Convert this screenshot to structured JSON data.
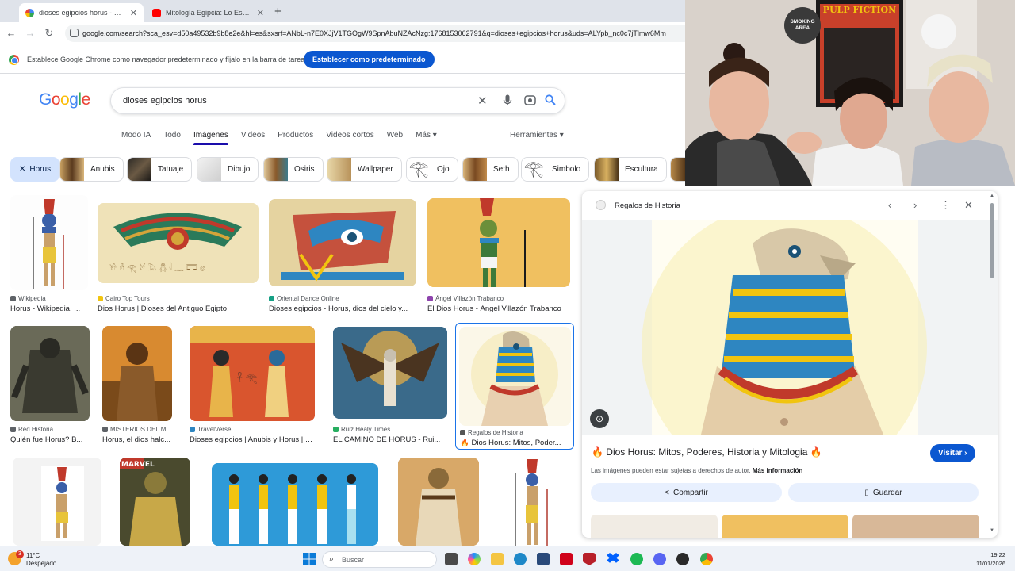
{
  "browser": {
    "tabs": [
      {
        "title": "dioses egipcios horus - Buscar",
        "active": true
      },
      {
        "title": "Mitología Egipcia: Lo Esencial -",
        "active": false
      }
    ],
    "url": "google.com/search?sca_esv=d50a49532b9b8e2e&hl=es&sxsrf=ANbL-n7E0XJjV1TGOgW9SpnAbuNZAcNzg:1768153062791&q=dioses+egipcios+horus&uds=ALYpb_nc0c7jTlmw6Mm",
    "infobar": {
      "message": "Establece Google Chrome como navegador predeterminado y fíjalo en la barra de tareas",
      "button": "Establecer como predeterminado"
    }
  },
  "google": {
    "logo": "Google",
    "query": "dioses egipcios horus",
    "nav": [
      "Modo IA",
      "Todo",
      "Imágenes",
      "Videos",
      "Productos",
      "Videos cortos",
      "Web",
      "Más ▾"
    ],
    "active_nav": "Imágenes",
    "tools": "Herramientas ▾",
    "chips": [
      "Horus",
      "Anubis",
      "Tatuaje",
      "Dibujo",
      "Osiris",
      "Wallpaper",
      "Ojo",
      "Seth",
      "Simbolo",
      "Escultura"
    ]
  },
  "results": [
    {
      "source": "Wikipedia",
      "title": "Horus - Wikipedia, ..."
    },
    {
      "source": "Cairo Top Tours",
      "title": "Dios Horus | Dioses del Antiguo Egipto"
    },
    {
      "source": "Oriental Dance Online",
      "title": "Dioses egipcios - Horus, dios del cielo y..."
    },
    {
      "source": "Ángel Villazón Trabanco",
      "title": "El Dios Horus - Ángel Villazón Trabanco"
    },
    {
      "source": "Red Historia",
      "title": "Quién fue Horus? B..."
    },
    {
      "source": "MISTERIOS DEL M...",
      "title": "Horus, el dios halc..."
    },
    {
      "source": "TravelVerse",
      "title": "Dioses egipcios | Anubis y Horus | T..."
    },
    {
      "source": "Ruiz Healy Times",
      "title": "EL CAMINO DE HORUS - Rui..."
    },
    {
      "source": "Regalos de Historia",
      "title": "🔥 Dios Horus: Mitos, Poder..."
    }
  ],
  "panel": {
    "source": "Regalos de Historia",
    "title": "🔥 Dios Horus: Mitos, Poderes, Historia y Mitologia 🔥",
    "visit": "Visitar ›",
    "copyright": "Las imágenes pueden estar sujetas a derechos de autor.",
    "more_info": "Más información",
    "share": "Compartir",
    "save": "Guardar"
  },
  "webcam": {
    "sign": "SMOKING AREA",
    "poster": "PULP FICTION"
  },
  "taskbar": {
    "temp": "11°C",
    "weather": "Despejado",
    "badge": "3",
    "search": "Buscar",
    "time": "19:22",
    "date": "11/01/2026"
  }
}
